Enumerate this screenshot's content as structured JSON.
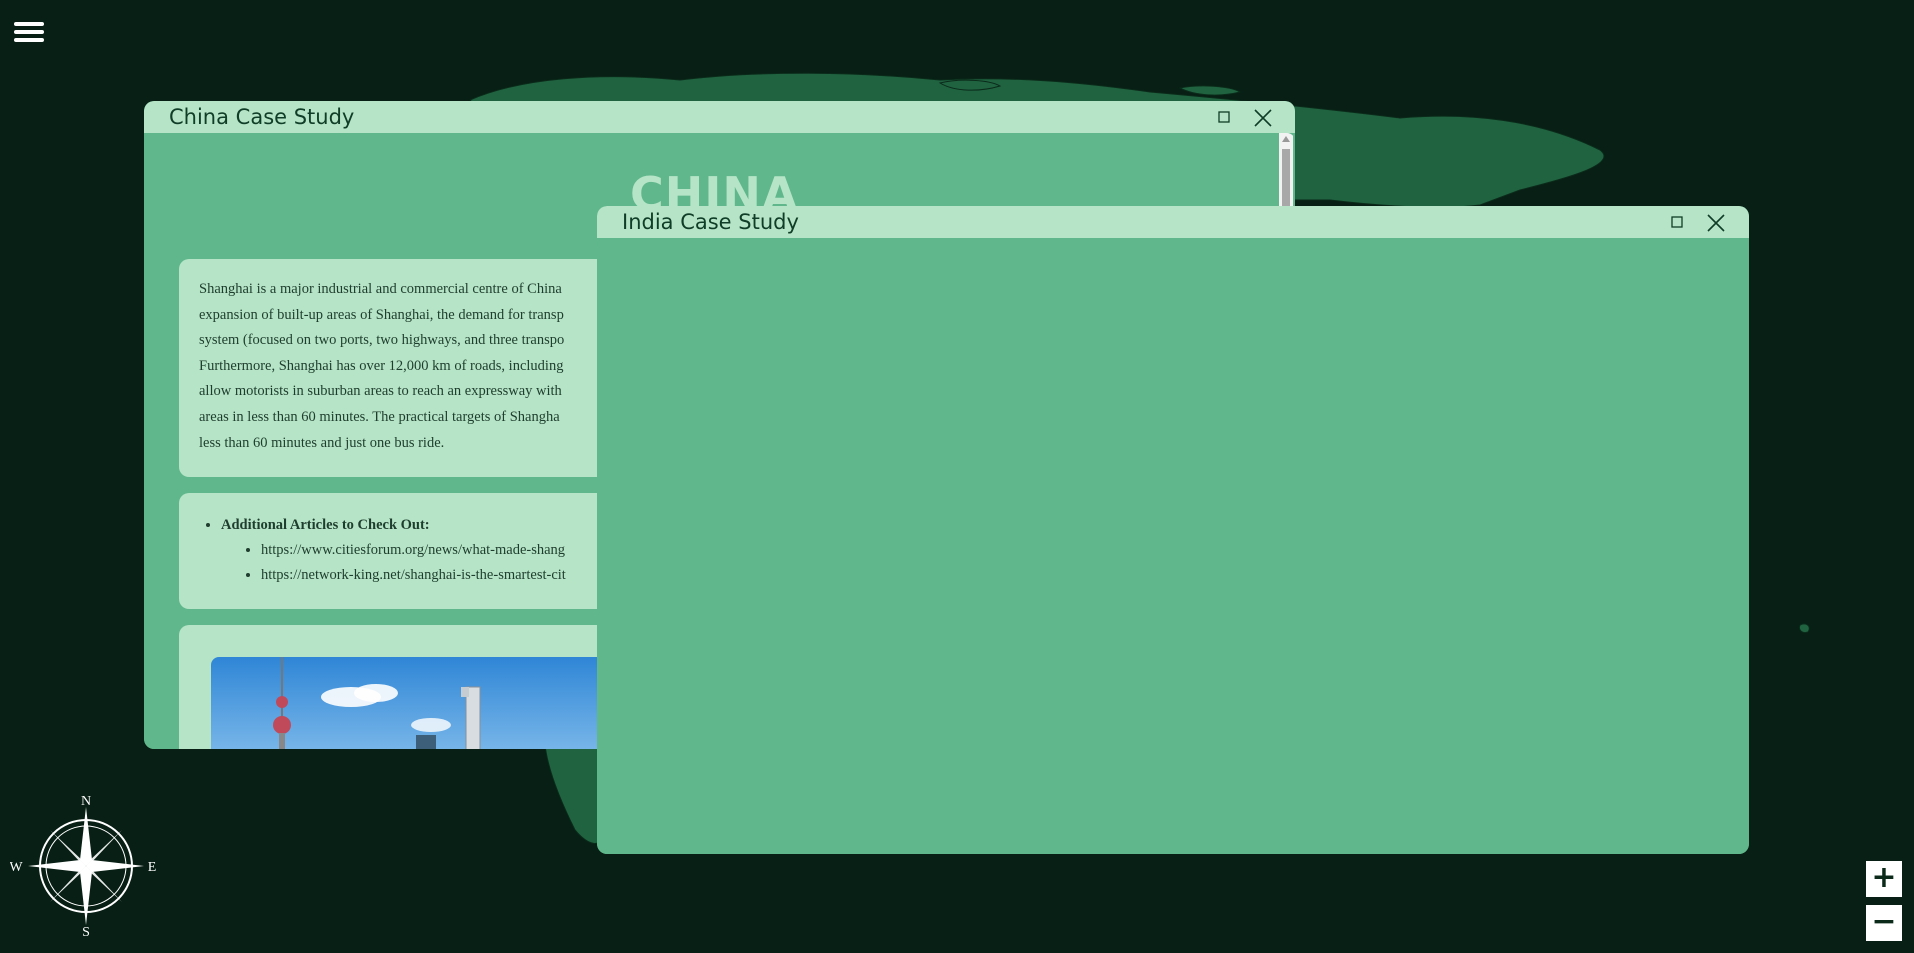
{
  "menu": {
    "icon": "hamburger-menu-icon"
  },
  "compass": {
    "north": "N",
    "south": "S",
    "east": "E",
    "west": "W"
  },
  "zoom": {
    "in_label": "+",
    "out_label": "−"
  },
  "windows": {
    "china": {
      "title": "China Case Study",
      "heading": "CHINA",
      "paragraph": "Shanghai is a major industrial and commercial centre of China expansion of built-up areas of Shanghai, the demand for transp system (focused on two ports, two highways, and three transpo Furthermore, Shanghai has over 12,000 km of roads, including allow motorists in suburban areas to reach an expressway with areas in less than 60 minutes. The practical targets of Shangha less than 60 minutes and just one bus ride.",
      "paragraph_lines": [
        "Shanghai is a major industrial and commercial centre of China",
        "expansion of built-up areas of Shanghai, the demand for transp",
        "system (focused on two ports, two highways, and three transpo",
        "Furthermore, Shanghai has over 12,000 km of roads, including",
        "allow motorists in suburban areas to reach an expressway with",
        "areas in less than 60 minutes. The practical targets of Shangha",
        "less than 60 minutes and just one bus ride."
      ],
      "links_heading": "Additional Articles to Check Out:",
      "links": [
        "https://www.citiesforum.org/news/what-made-shang",
        "https://network-king.net/shanghai-is-the-smartest-cit"
      ]
    },
    "india": {
      "title": "India Case Study"
    }
  },
  "colors": {
    "background": "#071f14",
    "land": "#1f6340",
    "window_body": "#5fb78b",
    "titlebar": "#b5e4c6"
  }
}
